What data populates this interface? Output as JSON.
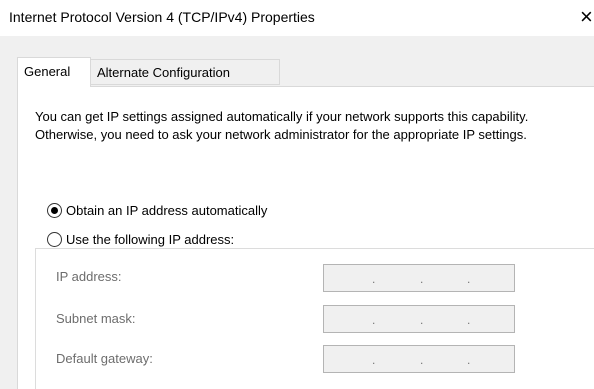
{
  "window": {
    "title": "Internet Protocol Version 4 (TCP/IPv4) Properties",
    "close_glyph": "×"
  },
  "tabs": [
    {
      "label": "General",
      "selected": true
    },
    {
      "label": "Alternate Configuration",
      "selected": false
    }
  ],
  "general": {
    "description": "You can get IP settings assigned automatically if your network supports this capability. Otherwise, you need to ask your network administrator for the appropriate IP settings.",
    "obtain_auto_label": "Obtain an IP address automatically",
    "obtain_auto_checked": true,
    "use_following_label": "Use the following IP address:",
    "use_following_checked": false,
    "fields": [
      {
        "label": "IP address:",
        "separator": "."
      },
      {
        "label": "Subnet mask:",
        "separator": "."
      },
      {
        "label": "Default gateway:",
        "separator": "."
      }
    ]
  }
}
